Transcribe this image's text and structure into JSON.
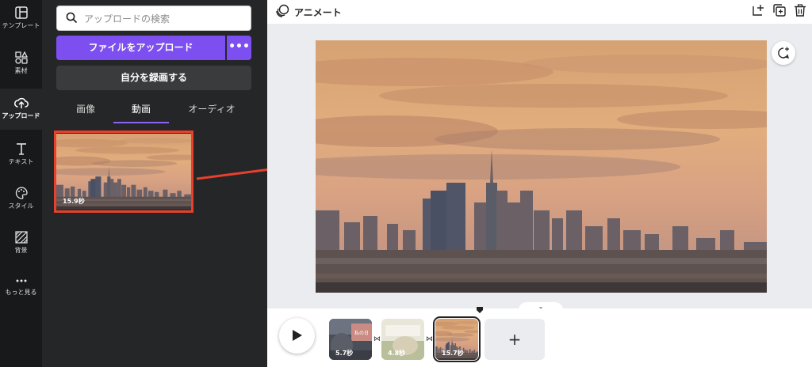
{
  "rail": {
    "items": [
      {
        "label": "テンプレート",
        "icon": "template-icon"
      },
      {
        "label": "素材",
        "icon": "elements-icon"
      },
      {
        "label": "アップロード",
        "icon": "upload-cloud-icon",
        "active": true
      },
      {
        "label": "テキスト",
        "icon": "text-icon"
      },
      {
        "label": "スタイル",
        "icon": "palette-icon"
      },
      {
        "label": "背景",
        "icon": "background-pattern-icon"
      },
      {
        "label": "もっと見る",
        "icon": "more-dots-icon"
      }
    ]
  },
  "panel": {
    "search_placeholder": "アップロードの検索",
    "upload_button": "ファイルをアップロード",
    "more_button": "•••",
    "record_button": "自分を録画する",
    "tabs": [
      "画像",
      "動画",
      "オーディオ"
    ],
    "active_tab": "動画",
    "video_duration": "15.9秒"
  },
  "topbar": {
    "title": "アニメート",
    "icons": [
      "animate-icon",
      "add-page-icon",
      "duplicate-page-icon",
      "trash-icon"
    ]
  },
  "timeline": {
    "pages": [
      {
        "duration": "5.7秒",
        "thumb_text": "私の日"
      },
      {
        "duration": "4.8秒"
      },
      {
        "duration": "15.7秒",
        "selected": true
      }
    ],
    "add_label": "+"
  },
  "colors": {
    "accent": "#7d4ff0",
    "rail_bg": "#18191b",
    "panel_bg": "#252627",
    "highlight": "#e8402d",
    "canvas_bg": "#ebecf0"
  }
}
